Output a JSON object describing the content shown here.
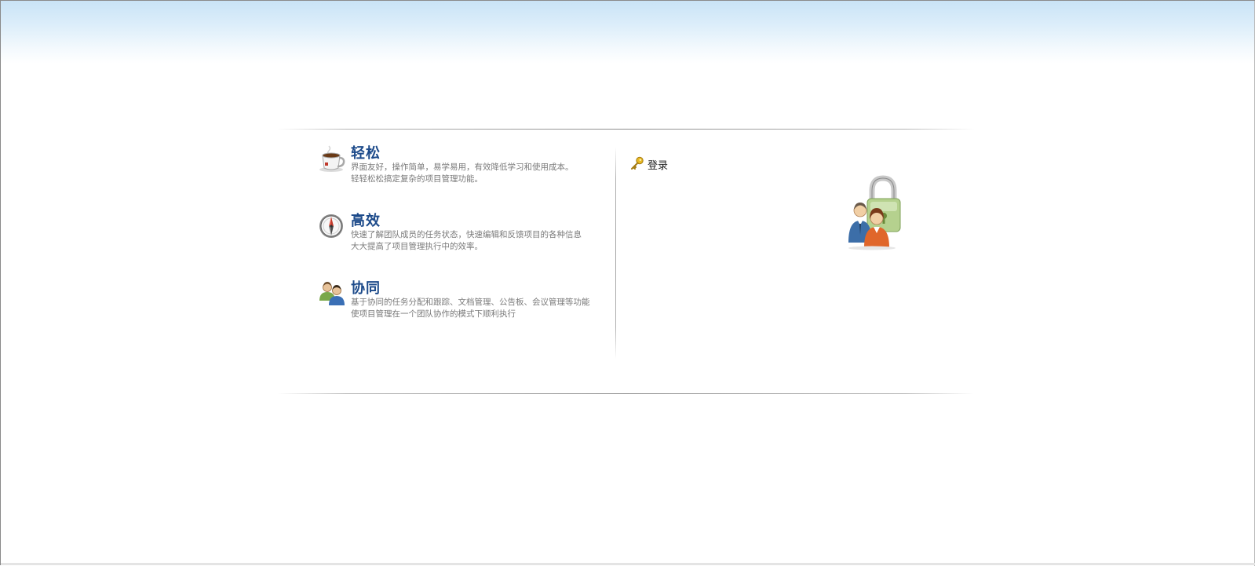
{
  "features": [
    {
      "icon": "coffee-cup-icon",
      "title": "轻松",
      "line1": "界面友好，操作简单，易学易用，有效降低学习和使用成本。",
      "line2": "轻轻松松搞定复杂的项目管理功能。"
    },
    {
      "icon": "compass-icon",
      "title": "高效",
      "line1": "快速了解团队成员的任务状态，快速编辑和反馈项目的各种信息",
      "line2": "大大提高了项目管理执行中的效率。"
    },
    {
      "icon": "team-users-icon",
      "title": "协同",
      "line1": "基于协同的任务分配和跟踪、文档管理、公告板、会议管理等功能",
      "line2": "使项目管理在一个团队协作的模式下顺利执行"
    }
  ],
  "login": {
    "title": "登录",
    "icon": "key-icon",
    "illustration": "users-lock-icon"
  }
}
